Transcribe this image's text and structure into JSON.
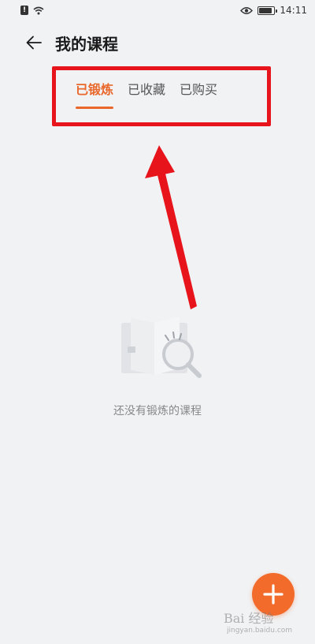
{
  "status_bar": {
    "time": "14:11",
    "alert_icon": "alert-icon",
    "wifi_icon": "wifi-icon",
    "eye_icon": "eye-icon",
    "battery_icon": "battery-icon"
  },
  "header": {
    "title": "我的课程",
    "back_icon": "back-arrow-icon"
  },
  "tabs": [
    {
      "label": "已锻炼",
      "active": true
    },
    {
      "label": "已收藏",
      "active": false
    },
    {
      "label": "已购买",
      "active": false
    }
  ],
  "empty_state": {
    "message": "还没有锻炼的课程",
    "illustration_icon": "book-search-icon"
  },
  "fab": {
    "icon": "plus-icon"
  },
  "watermark": {
    "text": "Bai 经验",
    "sub": "jingyan.baidu.com"
  },
  "colors": {
    "accent": "#e9672a",
    "fab": "#f26b2b",
    "annotation_red": "#e8141b",
    "background": "#f1f2f4"
  }
}
